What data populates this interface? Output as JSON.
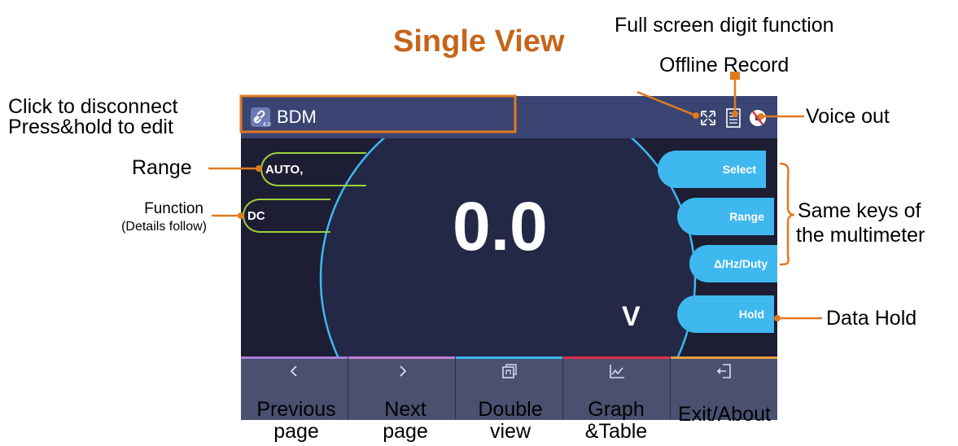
{
  "title": "Single View",
  "annotations": {
    "full_screen": "Full screen digit function",
    "offline_record": "Offline Record",
    "disconnect_line1": "Click to disconnect",
    "disconnect_line2": "Press&hold to edit",
    "voice_out": "Voice out",
    "range": "Range",
    "function": "Function",
    "function_sub": "(Details follow)",
    "same_keys_line1": "Same keys of",
    "same_keys_line2": "the multimeter",
    "data_hold": "Data Hold"
  },
  "device": {
    "name": "BDM",
    "link_badge": "4.0",
    "left_keys": {
      "range_value": "AUTO,",
      "function_value": "DC"
    },
    "right_keys": [
      "Select",
      "Range",
      "Δ/Hz/Duty",
      "Hold"
    ],
    "reading": "0.0",
    "unit": "V",
    "icons": {
      "link": "link-icon",
      "fullscreen": "fullscreen-icon",
      "record": "record-icon",
      "voice": "mute-icon"
    },
    "nav": [
      {
        "icon": "chevron-left-icon",
        "glyph": "<",
        "strip": "#a57fd6",
        "label_line1": "Previous",
        "label_line2": "page"
      },
      {
        "icon": "chevron-right-icon",
        "glyph": ">",
        "strip": "#c07fd6",
        "label_line1": "Next",
        "label_line2": "page"
      },
      {
        "icon": "double-view-icon",
        "glyph": "",
        "strip": "#3fb8ef",
        "label_line1": "Double",
        "label_line2": "view"
      },
      {
        "icon": "graph-icon",
        "glyph": "",
        "strip": "#e0304a",
        "label_line1": "Graph",
        "label_line2": "&Table"
      },
      {
        "icon": "exit-icon",
        "glyph": "",
        "strip": "#e8a03a",
        "label_line1": "Exit/About",
        "label_line2": ""
      }
    ]
  },
  "colors": {
    "title": "#c5651a",
    "callout": "#e07a1f",
    "topbar": "#3a4472",
    "screen": "#1d1d33",
    "accent_blue": "#3fb8ef",
    "accent_green": "#9ccf3a",
    "navbar": "#4a5070"
  }
}
